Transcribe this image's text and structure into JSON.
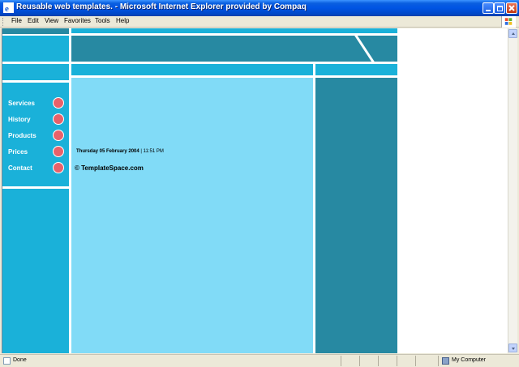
{
  "window": {
    "title": "Reusable web templates. - Microsoft Internet Explorer provided by Compaq",
    "buttons": {
      "minimize": "minimize",
      "maximize": "maximize",
      "close": "close"
    }
  },
  "menu": {
    "items": [
      "File",
      "Edit",
      "View",
      "Favorites",
      "Tools",
      "Help"
    ]
  },
  "page": {
    "nav": [
      {
        "label": "Services"
      },
      {
        "label": "History"
      },
      {
        "label": "Products"
      },
      {
        "label": "Prices"
      },
      {
        "label": "Contact"
      }
    ],
    "date": "Thursday 05 February 2004",
    "separator": "|",
    "time": "11:51 PM",
    "copyright": "© TemplateSpace.com",
    "colors": {
      "light": "#1ab1d9",
      "dark": "#2789a2",
      "pale": "#81dbf7",
      "dot": "#e8616a"
    }
  },
  "statusbar": {
    "status": "Done",
    "zone": "My Computer"
  }
}
